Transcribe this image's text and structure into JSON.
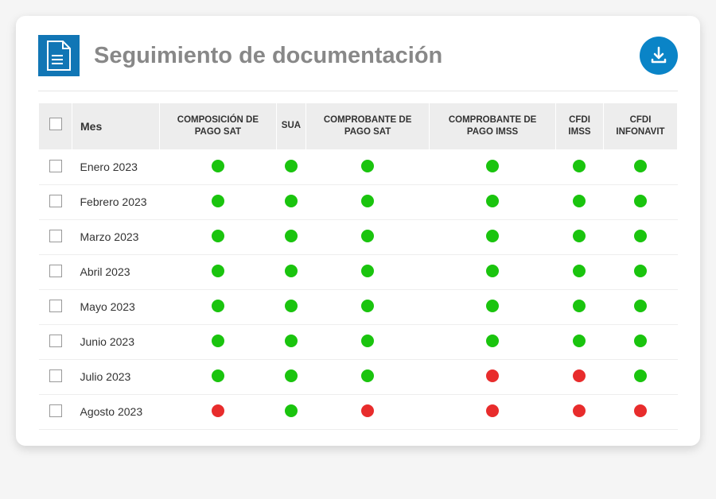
{
  "header": {
    "title": "Seguimiento de documentación"
  },
  "table": {
    "columns": {
      "mes": "Mes",
      "composicion_pago_sat": "COMPOSICIÓN DE PAGO SAT",
      "sua": "SUA",
      "comprobante_pago_sat": "COMPROBANTE DE PAGO SAT",
      "comprobante_pago_imss": "COMPROBANTE DE PAGO IMSS",
      "cfdi_imss": "CFDI IMSS",
      "cfdi_infonavit": "CFDI INFONAVIT"
    },
    "rows": [
      {
        "mes": "Enero 2023",
        "statuses": [
          "green",
          "green",
          "green",
          "green",
          "green",
          "green"
        ]
      },
      {
        "mes": "Febrero 2023",
        "statuses": [
          "green",
          "green",
          "green",
          "green",
          "green",
          "green"
        ]
      },
      {
        "mes": "Marzo 2023",
        "statuses": [
          "green",
          "green",
          "green",
          "green",
          "green",
          "green"
        ]
      },
      {
        "mes": "Abril 2023",
        "statuses": [
          "green",
          "green",
          "green",
          "green",
          "green",
          "green"
        ]
      },
      {
        "mes": "Mayo 2023",
        "statuses": [
          "green",
          "green",
          "green",
          "green",
          "green",
          "green"
        ]
      },
      {
        "mes": "Junio 2023",
        "statuses": [
          "green",
          "green",
          "green",
          "green",
          "green",
          "green"
        ]
      },
      {
        "mes": "Julio 2023",
        "statuses": [
          "green",
          "green",
          "green",
          "red",
          "red",
          "green"
        ]
      },
      {
        "mes": "Agosto 2023",
        "statuses": [
          "red",
          "green",
          "red",
          "red",
          "red",
          "red"
        ]
      }
    ]
  },
  "colors": {
    "green": "#1ac40e",
    "red": "#e82c2c",
    "accent": "#1176b5",
    "download": "#0a84c7"
  }
}
